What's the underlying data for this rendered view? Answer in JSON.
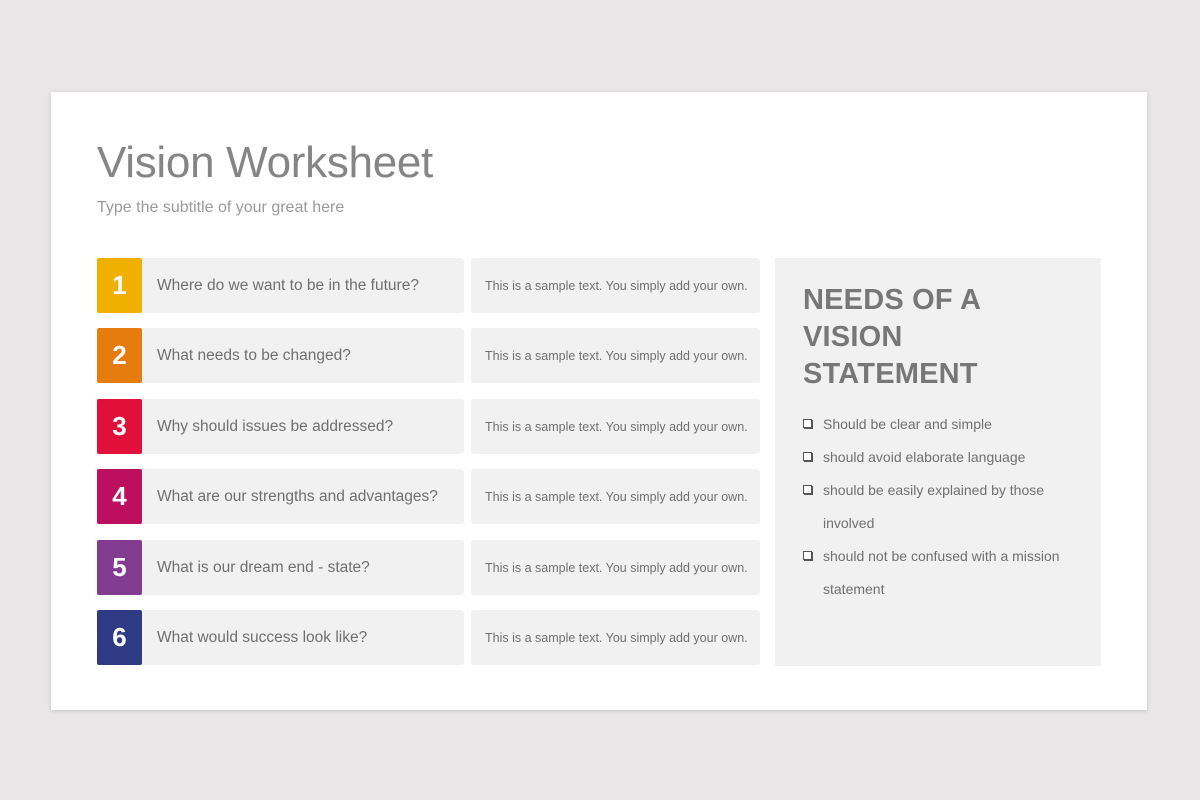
{
  "slide": {
    "title": "Vision Worksheet",
    "subtitle": "Type the subtitle of your great here"
  },
  "rows": [
    {
      "number": "1",
      "question": "Where do we want to be in the future?",
      "answer": "This is a sample text. You simply add your own.",
      "color": "#f0b000"
    },
    {
      "number": "2",
      "question": "What needs to be changed?",
      "answer": "This is a sample text. You simply add your own.",
      "color": "#e67c0e"
    },
    {
      "number": "3",
      "question": "Why should issues be addressed?",
      "answer": "This is a sample text. You simply add your own.",
      "color": "#e0103a"
    },
    {
      "number": "4",
      "question": "What are our strengths and advantages?",
      "answer": "This is a sample text. You simply add your own.",
      "color": "#bc0f5f"
    },
    {
      "number": "5",
      "question": "What is our dream end - state?",
      "answer": "This is a sample text. You simply add your own.",
      "color": "#813c8f"
    },
    {
      "number": "6",
      "question": "What would success look like?",
      "answer": "This is a sample text. You simply add your own.",
      "color": "#2f3b85"
    }
  ],
  "side": {
    "heading": "NEEDS OF A VISION STATEMENT",
    "items": [
      "Should be clear and simple",
      "should avoid elaborate language",
      "should be easily explained by those involved",
      "should not be confused with a mission statement"
    ],
    "bullet_icon": "checkbox-icon"
  }
}
